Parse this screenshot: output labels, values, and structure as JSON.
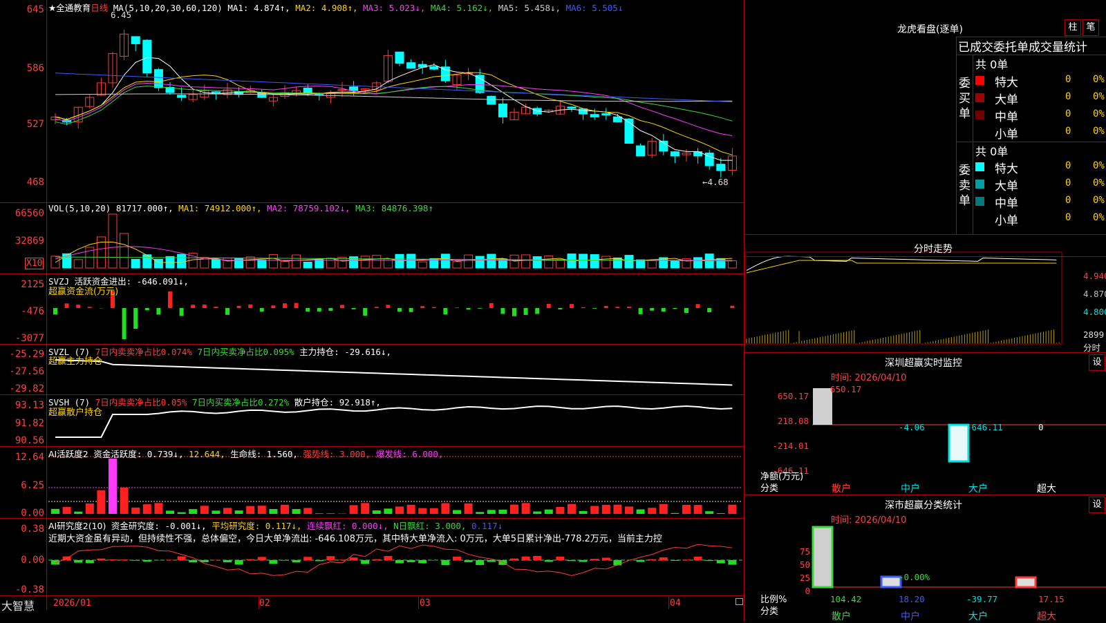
{
  "main": {
    "y_labels": [
      "645",
      "586",
      "527",
      "468"
    ],
    "title": "★全通教育",
    "period": "日线",
    "ma_label": "MA(5,10,20,30,60,120)",
    "ma": [
      {
        "text": "MA1: 4.874↑,",
        "color": "#ffffff"
      },
      {
        "text": "MA2: 4.908↑,",
        "color": "#ffd400"
      },
      {
        "text": "MA3: 5.023↓,",
        "color": "#ff3bff"
      },
      {
        "text": "MA4: 5.162↓,",
        "color": "#3bd83b"
      },
      {
        "text": "MA5: 5.458↓,",
        "color": "#cccccc"
      },
      {
        "text": "MA6: 5.505↓",
        "color": "#3b5bff"
      }
    ],
    "high_mark": "6.45",
    "low_mark": "←4.68"
  },
  "vol": {
    "y_labels": [
      "66560",
      "32869"
    ],
    "unit": "X10",
    "label": "VOL(5,10,20)",
    "value": "81717.000↑,",
    "ma": [
      {
        "text": "MA1: 74912.000↑,",
        "color": "#ffd400"
      },
      {
        "text": "MA2: 78759.102↓,",
        "color": "#ff3bff"
      },
      {
        "text": "MA3: 84876.398↑",
        "color": "#3bd83b"
      }
    ]
  },
  "svzj": {
    "y_labels": [
      "2125",
      "-476",
      "-3077"
    ],
    "label": "SVZJ  活跃资金进出: -646.091↓,",
    "sub": "超赢资金流(万元)"
  },
  "svzl": {
    "y_labels": [
      "-25.29",
      "-27.56",
      "-29.82"
    ],
    "prefix": "SVZL (7)",
    "red_text": "7日内卖卖净占比0.074%",
    "green_text": "7日内买卖净占比0.095%",
    "white_text": "主力持仓: -29.616↓,",
    "sub": "超赢主力持仓"
  },
  "svsh": {
    "y_labels": [
      "93.13",
      "91.82",
      "90.56"
    ],
    "prefix": "SVSH (7)",
    "red_text": "7日内卖卖净占比0.05%",
    "green_text": "7日内买卖净占比0.272%",
    "white_text": "散户持仓: 92.918↑,",
    "sub": "超赢散户持仓"
  },
  "ai_active": {
    "y_labels": [
      "12.64",
      "6.25",
      "0.00"
    ],
    "prefix": "AI活跃度2",
    "items": [
      {
        "text": "资金活跃度: 0.739↓,",
        "color": "#ffffff"
      },
      {
        "text": "12.644,",
        "color": "#ffd400"
      },
      {
        "text": "生命线: 1.560,",
        "color": "#ffffff"
      },
      {
        "text": "强势线: 3.000,",
        "color": "#ff3b3b"
      },
      {
        "text": "爆发线: 6.000,",
        "color": "#ff3bff"
      }
    ]
  },
  "ai_research": {
    "y_labels": [
      "0.38",
      "0.00",
      "-0.38"
    ],
    "prefix": "AI研究度2(10)",
    "items": [
      {
        "text": "资金研究度: -0.001↓,",
        "color": "#ffffff"
      },
      {
        "text": "平均研究度: 0.117↓,",
        "color": "#ffd400"
      },
      {
        "text": "连续飘红: 0.000↓,",
        "color": "#ff3bff"
      },
      {
        "text": "N日飘红: 3.000,",
        "color": "#3bd83b"
      },
      {
        "text": "0.117↓",
        "color": "#3b5bff"
      }
    ],
    "commentary": "近期大资金虽有异动，但持续性不强，总体偏空，今日大单净流出: -646.108万元，其中特大单净流入: 0万元，大单5日累计净出-778.2万元，当前主力控"
  },
  "xaxis": {
    "brand": "大智慧",
    "dates": [
      "2026/01",
      "02",
      "03",
      "04"
    ]
  },
  "lhb": {
    "title": "龙虎看盘(逐单)",
    "btn1": "柱",
    "btn2": "笔",
    "header": "已成交委托单成交量统计",
    "buy_label": "委买单",
    "sell_label": "委卖单",
    "buy_total": "共 0单",
    "sell_total": "共 0单",
    "buy_rows": [
      {
        "name": "特大",
        "count": "0",
        "pct": "0%",
        "color": "#ff0000"
      },
      {
        "name": "大单",
        "count": "0",
        "pct": "0%",
        "color": "#a00000"
      },
      {
        "name": "中单",
        "count": "0",
        "pct": "0%",
        "color": "#700000"
      },
      {
        "name": "小单",
        "count": "0",
        "pct": "0%",
        "color": "#000000"
      }
    ],
    "sell_rows": [
      {
        "name": "特大",
        "count": "0",
        "pct": "0%",
        "color": "#00ffff"
      },
      {
        "name": "大单",
        "count": "0",
        "pct": "0%",
        "color": "#00a0a0"
      },
      {
        "name": "中单",
        "count": "0",
        "pct": "0%",
        "color": "#007a7a"
      },
      {
        "name": "小单",
        "count": "0",
        "pct": "0%",
        "color": "#000000"
      }
    ]
  },
  "intraday": {
    "title": "分时走势",
    "y_labels": [
      "4.940",
      "4.870",
      "4.800",
      "2899",
      "分时"
    ]
  },
  "sz_monitor": {
    "title": "深圳超赢实时监控",
    "btn": "设",
    "time": "时间: 2026/04/10",
    "y_labels": [
      "650.17",
      "218.08",
      "-214.01",
      "-646.11"
    ],
    "unit_label": "净额(万元)",
    "cat_label": "分类",
    "values": [
      "650.17",
      "-4.06",
      "-646.11",
      "0"
    ],
    "cats": [
      "散户",
      "中户",
      "大户",
      "超大"
    ]
  },
  "sz_stats": {
    "title": "深市超赢分类统计",
    "btn": "设",
    "time": "时间: 2026/04/10",
    "y_labels": [
      "75",
      "50",
      "25",
      "0"
    ],
    "unit_label": "比例%",
    "cat_label": "分类",
    "values": [
      "104.42",
      "18.20",
      "-39.77",
      "17.15"
    ],
    "mid_label": "-0.00%",
    "cats": [
      "散户",
      "中户",
      "大户",
      "超大"
    ]
  }
}
